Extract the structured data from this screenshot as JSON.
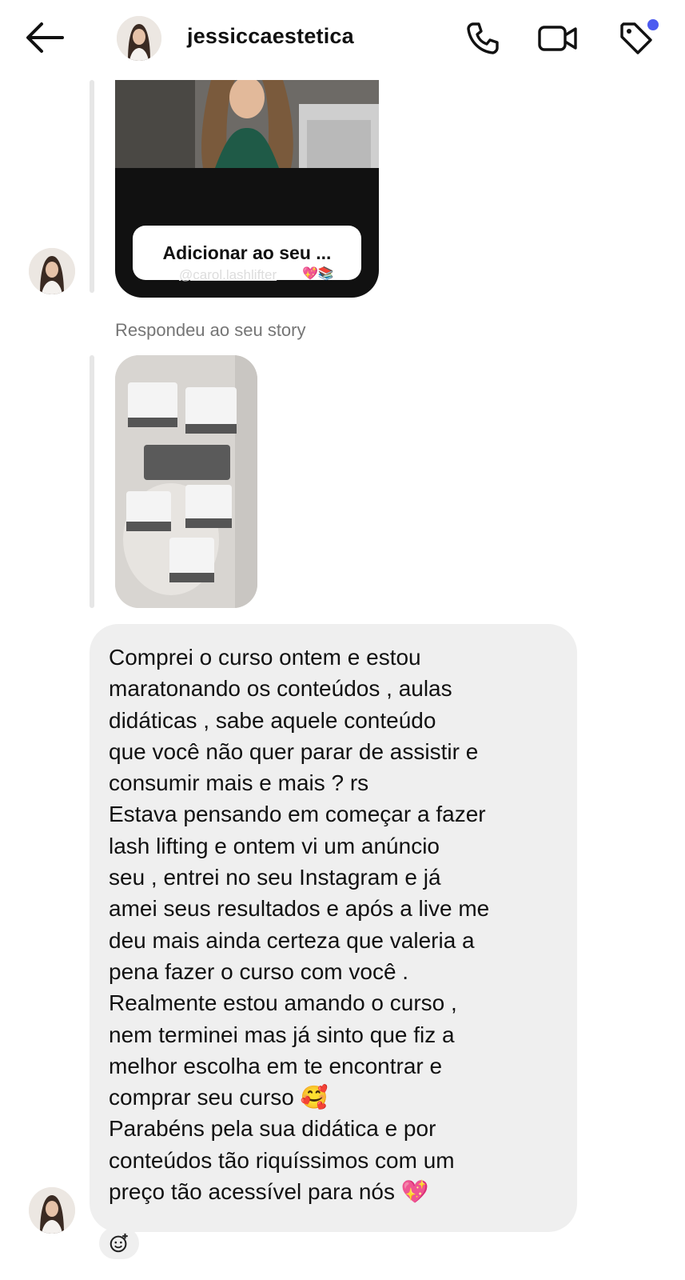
{
  "header": {
    "username": "jessiccaestetica",
    "icons": [
      "back-arrow-icon",
      "phone-icon",
      "video-camera-icon",
      "tag-icon"
    ],
    "notification_dot_color": "#4c5bf0"
  },
  "story_card": {
    "mention": "@carol.lashlifter",
    "mention_emoji": "💖📚",
    "add_button_label": "Adicionar ao seu ..."
  },
  "replied_label": "Respondeu ao seu story",
  "message": {
    "text": "Comprei o curso ontem e estou\nmaratonando os conteúdos , aulas\ndidáticas , sabe aquele conteúdo\nque você não quer parar de assistir e\nconsumir mais e mais ? rs\nEstava pensando em começar a fazer\nlash lifting e ontem vi um anúncio\nseu , entrei no seu Instagram e já\namei seus resultados e após a live me\ndeu mais ainda certeza que valeria a\npena fazer o curso com você .\nRealmente estou amando o curso ,\nnem terminei mas já sinto que fiz a\nmelhor escolha em te encontrar e\ncomprar seu curso 🥰\nParabéns pela sua didática e por\nconteúdos tão riquíssimos com um\npreço tão acessível para nós 💖"
  },
  "colors": {
    "bubble": "#efefef",
    "story_card_bg": "#111111",
    "secondary_text": "#757575"
  }
}
